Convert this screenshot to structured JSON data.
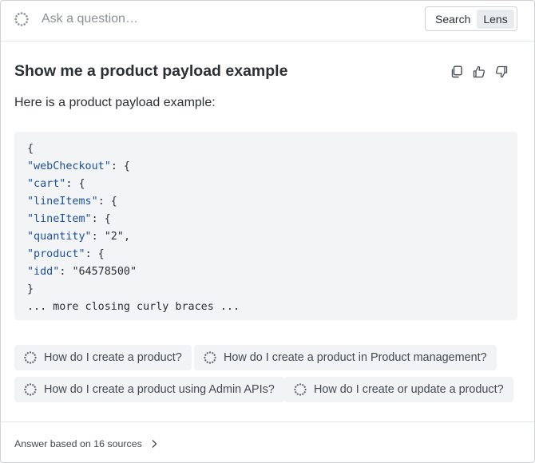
{
  "search": {
    "placeholder": "Ask a question…",
    "mode_search_label": "Search",
    "mode_lens_label": "Lens",
    "active_mode": "Lens"
  },
  "answer": {
    "question": "Show me a product payload example",
    "intro": "Here is a product payload example:",
    "code_lines": [
      [
        {
          "t": "{",
          "k": "punc"
        }
      ],
      [
        {
          "t": "\"webCheckout\"",
          "k": "key"
        },
        {
          "t": ": {",
          "k": "punc"
        }
      ],
      [
        {
          "t": "\"cart\"",
          "k": "key"
        },
        {
          "t": ": {",
          "k": "punc"
        }
      ],
      [
        {
          "t": "\"lineItems\"",
          "k": "key"
        },
        {
          "t": ": {",
          "k": "punc"
        }
      ],
      [
        {
          "t": "\"lineItem\"",
          "k": "key"
        },
        {
          "t": ": {",
          "k": "punc"
        }
      ],
      [
        {
          "t": "\"quantity\"",
          "k": "key"
        },
        {
          "t": ": ",
          "k": "punc"
        },
        {
          "t": "\"2\"",
          "k": "str"
        },
        {
          "t": ",",
          "k": "punc"
        }
      ],
      [
        {
          "t": "\"product\"",
          "k": "key"
        },
        {
          "t": ": {",
          "k": "punc"
        }
      ],
      [
        {
          "t": "\"idd\"",
          "k": "key"
        },
        {
          "t": ": ",
          "k": "punc"
        },
        {
          "t": "\"64578500\"",
          "k": "str"
        }
      ],
      [
        {
          "t": "}",
          "k": "punc"
        }
      ],
      [
        {
          "t": "... more closing curly braces ...",
          "k": "punc"
        }
      ]
    ],
    "actions": [
      {
        "icon": "copy-icon"
      },
      {
        "icon": "thumbs-up-icon"
      },
      {
        "icon": "thumbs-down-icon"
      }
    ]
  },
  "suggestions": [
    {
      "label": "How do I create a product?"
    },
    {
      "label": "How do I create a product in Product management?"
    },
    {
      "label": "How do I create a product using Admin APIs?"
    },
    {
      "label": "How do I create or update a product?"
    }
  ],
  "footer": {
    "sources_label": "Answer based on 16 sources"
  },
  "colors": {
    "code_key": "#1b4f9c",
    "code_background": "#f3f4f6",
    "chip_background": "#f1f3f5",
    "border": "#cfd3d7"
  }
}
